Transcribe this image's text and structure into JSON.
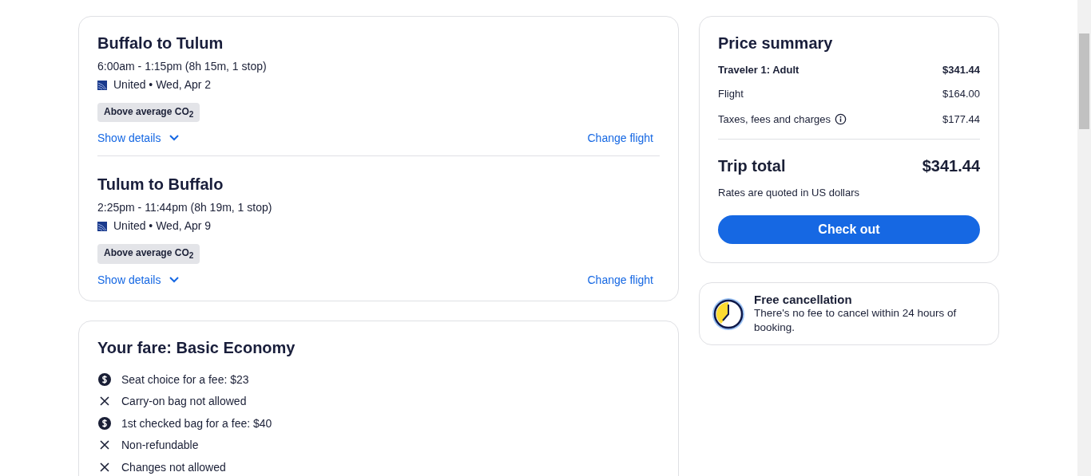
{
  "flights": [
    {
      "title": "Buffalo to Tulum",
      "times": "6:00am - 1:15pm (8h 15m, 1 stop)",
      "airline": "United • Wed, Apr 2",
      "badge": "Above average CO$_{2}$",
      "details_link": "Show details",
      "change_link": "Change flight"
    },
    {
      "title": "Tulum to Buffalo",
      "times": "2:25pm - 11:44pm (8h 19m, 1 stop)",
      "airline": "United • Wed, Apr 9",
      "badge": "Above average CO$_{2}$",
      "details_link": "Show details",
      "change_link": "Change flight"
    }
  ],
  "fare": {
    "title": "Your fare: Basic Economy",
    "items": [
      {
        "kind": "fee",
        "text": "Seat choice for a fee: $23"
      },
      {
        "kind": "no",
        "text": "Carry-on bag not allowed"
      },
      {
        "kind": "fee",
        "text": "1st checked bag for a fee: $40"
      },
      {
        "kind": "no",
        "text": "Non-refundable"
      },
      {
        "kind": "no",
        "text": "Changes not allowed"
      }
    ]
  },
  "price_summary": {
    "title": "Price summary",
    "rows": [
      {
        "kind": "header",
        "label": "Traveler 1: Adult",
        "amount": "$341.44",
        "info": false
      },
      {
        "kind": "line",
        "label": "Flight",
        "amount": "$164.00",
        "info": false
      },
      {
        "kind": "line",
        "label": "Taxes, fees and charges",
        "amount": "$177.44",
        "info": true
      }
    ],
    "total_label": "Trip total",
    "total_amount": "$341.44",
    "note": "Rates are quoted in US dollars",
    "button": "Check out"
  },
  "cancellation": {
    "title": "Free cancellation",
    "text": "There's no fee to cancel within 24 hours of booking."
  }
}
